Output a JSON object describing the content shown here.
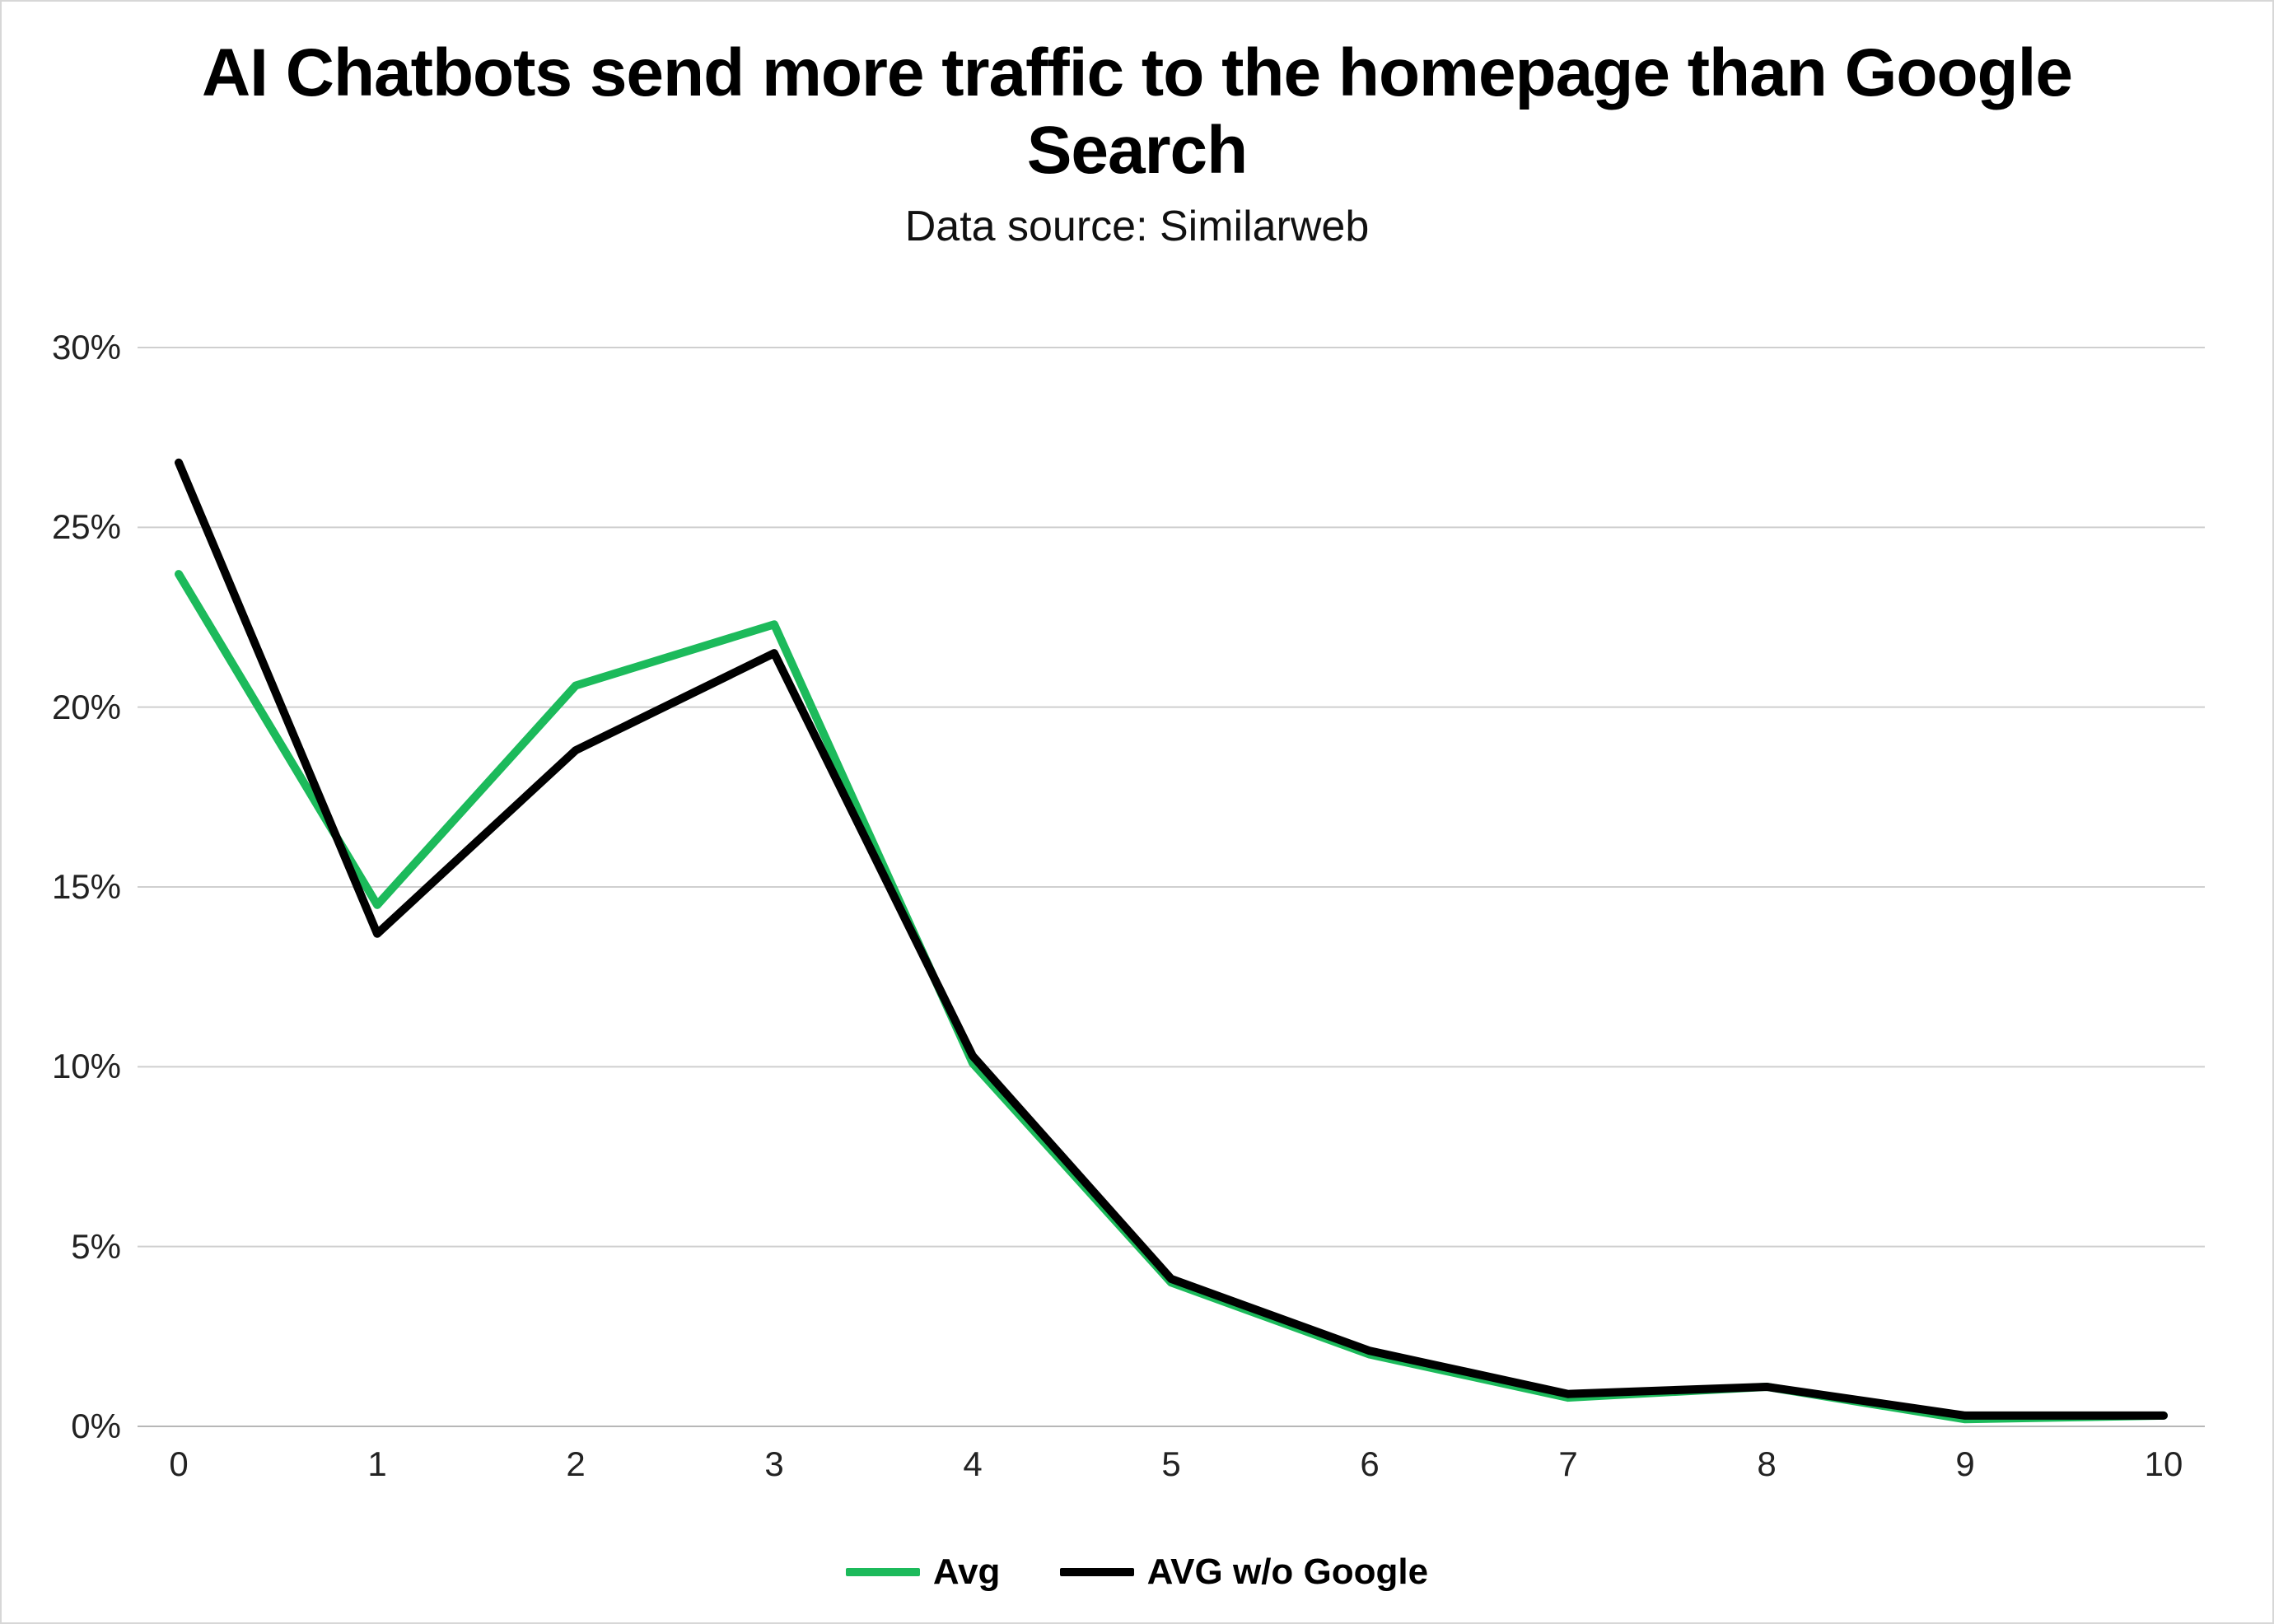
{
  "chart_data": {
    "type": "line",
    "title": "AI Chatbots send more traffic to the homepage than Google Search",
    "subtitle": "Data source: Similarweb",
    "xlabel": "",
    "ylabel": "",
    "x": [
      0,
      1,
      2,
      3,
      4,
      5,
      6,
      7,
      8,
      9,
      10
    ],
    "ylim": [
      0,
      30
    ],
    "y_ticks": [
      "0%",
      "5%",
      "10%",
      "15%",
      "20%",
      "25%",
      "30%"
    ],
    "x_ticks": [
      "0",
      "1",
      "2",
      "3",
      "4",
      "5",
      "6",
      "7",
      "8",
      "9",
      "10"
    ],
    "series": [
      {
        "name": "Avg",
        "color": "#1cba5b",
        "values": [
          23.7,
          14.5,
          20.6,
          22.3,
          10.1,
          4.0,
          2.0,
          0.8,
          1.1,
          0.2,
          0.3
        ]
      },
      {
        "name": "AVG w/o Google",
        "color": "#000000",
        "values": [
          26.8,
          13.7,
          18.8,
          21.5,
          10.3,
          4.1,
          2.1,
          0.9,
          1.1,
          0.3,
          0.3
        ]
      }
    ],
    "legend_position": "bottom",
    "grid": true
  }
}
